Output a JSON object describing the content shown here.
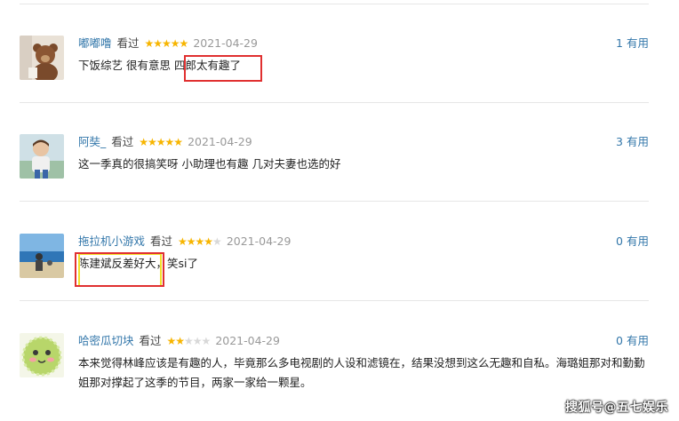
{
  "watched_label": "看过",
  "useful_suffix": "有用",
  "reviews": [
    {
      "user": "嘟嘟噜",
      "rating": 5,
      "date": "2021-04-29",
      "useful_count": "1",
      "text_before": "下饭综艺 很有意思 ",
      "text_boxed": "四郎太有趣了",
      "text_after": ""
    },
    {
      "user": "阿奘_",
      "rating": 5,
      "date": "2021-04-29",
      "useful_count": "3",
      "text": "这一季真的很搞笑呀 小助理也有趣 几对夫妻也选的好"
    },
    {
      "user": "拖拉机小游戏",
      "rating": 4,
      "date": "2021-04-29",
      "useful_count": "0",
      "text_boxed": "陈建斌反差好大",
      "text_after": "，笑si了"
    },
    {
      "user": "哈密瓜切块",
      "rating": 2,
      "date": "2021-04-29",
      "useful_count": "0",
      "text": "本来觉得林峰应该是有趣的人，毕竟那么多电视剧的人设和滤镜在，结果没想到这么无趣和自私。海璐姐那对和勤勤姐那对撑起了这季的节目，两家一家给一颗星。"
    }
  ],
  "watermark": "搜狐号@五七娱乐",
  "colors": {
    "link": "#3377aa",
    "star": "#f7b500",
    "highlight_red": "#e03030",
    "highlight_yellow": "#f2e12a"
  }
}
